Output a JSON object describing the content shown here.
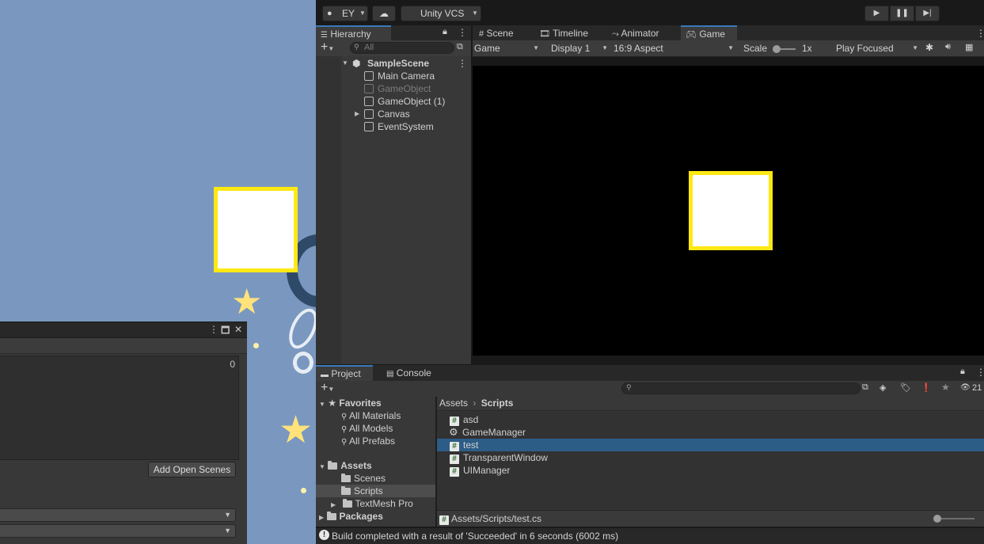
{
  "toolbar": {
    "account_label": "EY",
    "vcs_label": "Unity VCS"
  },
  "hierarchy": {
    "tab_label": "Hierarchy",
    "search_placeholder": "All",
    "scene_name": "SampleScene",
    "items": [
      {
        "label": "Main Camera",
        "dimmed": false
      },
      {
        "label": "GameObject",
        "dimmed": true
      },
      {
        "label": "GameObject (1)",
        "dimmed": false
      },
      {
        "label": "Canvas",
        "dimmed": false,
        "expandable": true
      },
      {
        "label": "EventSystem",
        "dimmed": false
      }
    ]
  },
  "view_tabs": [
    "Scene",
    "Timeline",
    "Animator",
    "Game"
  ],
  "game_toolbar": {
    "view_select": "Game",
    "display_select": "Display 1",
    "aspect_select": "16:9 Aspect",
    "scale_label": "Scale",
    "scale_value": "1x",
    "play_mode": "Play Focused"
  },
  "project": {
    "tabs": [
      "Project",
      "Console"
    ],
    "hidden_count": "21",
    "favorites_label": "Favorites",
    "favorites": [
      "All Materials",
      "All Models",
      "All Prefabs"
    ],
    "assets_label": "Assets",
    "asset_folders": [
      "Scenes",
      "Scripts",
      "TextMesh Pro"
    ],
    "packages_label": "Packages",
    "breadcrumb": [
      "Assets",
      "Scripts"
    ],
    "files": [
      {
        "name": "asd",
        "icon": "script-icon"
      },
      {
        "name": "GameManager",
        "icon": "gear-icon"
      },
      {
        "name": "test",
        "icon": "script-icon",
        "selected": true
      },
      {
        "name": "TransparentWindow",
        "icon": "script-icon"
      },
      {
        "name": "UIManager",
        "icon": "script-icon"
      }
    ],
    "selected_path": "Assets/Scripts/test.cs"
  },
  "status": {
    "message": "Build completed with a result of 'Succeeded' in 6 seconds (6002 ms)"
  },
  "build_window": {
    "scene_count": "0",
    "add_open_scenes_label": "Add Open Scenes"
  },
  "colors": {
    "accent_blue": "#3a79bb",
    "selection": "#2c5d87",
    "square_border": "#ffe813",
    "desktop_bg": "#7a98bf"
  }
}
